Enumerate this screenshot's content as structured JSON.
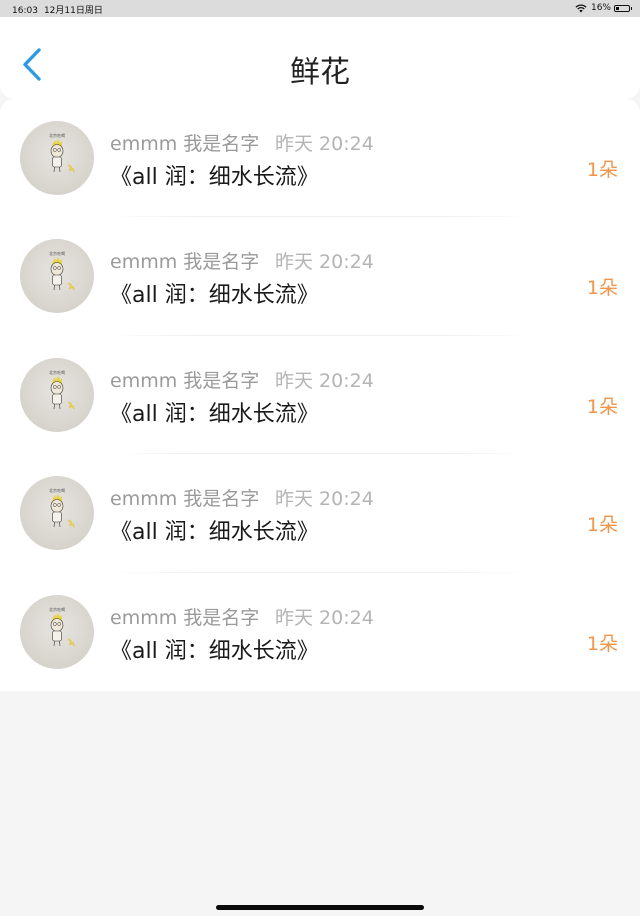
{
  "status_bar": {
    "time": "16:03",
    "date": "12月11日周日",
    "battery": "16%",
    "wifi_icon": "wifi-icon",
    "battery_icon": "battery-icon"
  },
  "nav": {
    "back_icon": "chevron-left-icon",
    "title": "鲜花",
    "accent_color": "#2a9ae3"
  },
  "items": [
    {
      "username": "emmm 我是名字",
      "time": "昨天 20:24",
      "book": "《all 润：细水长流》",
      "count": "1朵"
    },
    {
      "username": "emmm 我是名字",
      "time": "昨天 20:24",
      "book": "《all 润：细水长流》",
      "count": "1朵"
    },
    {
      "username": "emmm 我是名字",
      "time": "昨天 20:24",
      "book": "《all 润：细水长流》",
      "count": "1朵"
    },
    {
      "username": "emmm 我是名字",
      "time": "昨天 20:24",
      "book": "《all 润：细水长流》",
      "count": "1朵"
    },
    {
      "username": "emmm 我是名字",
      "time": "昨天 20:24",
      "book": "《all 润：细水长流》",
      "count": "1朵"
    }
  ],
  "colors": {
    "count": "#f0954a",
    "username": "#9a9a9a",
    "time": "#b4b4b4"
  }
}
